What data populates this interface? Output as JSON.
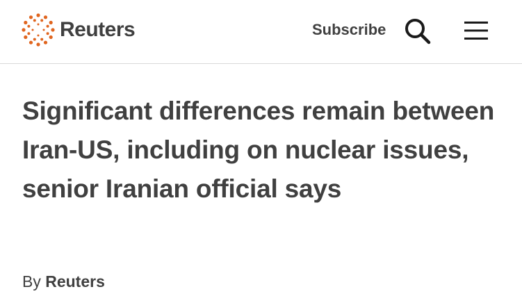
{
  "header": {
    "brand_name": "Reuters",
    "subscribe_label": "Subscribe",
    "search_icon": "search-icon",
    "menu_icon": "hamburger-menu-icon",
    "brand_color": "#e0651f"
  },
  "article": {
    "headline": "Significant differences remain between Iran-US, including on nuclear issues, senior Iranian official says",
    "byline_prefix": "By",
    "byline_author": "Reuters"
  }
}
